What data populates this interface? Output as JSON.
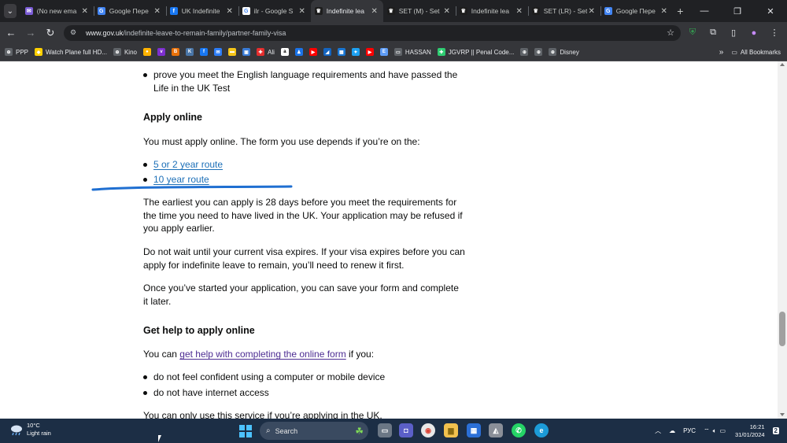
{
  "browser": {
    "tabs": [
      {
        "title": "(No new ema",
        "fav_color": "#7b5cd6",
        "fav_char": "✉",
        "active": false
      },
      {
        "title": "Google Пере",
        "fav_color": "#4285f4",
        "fav_char": "G",
        "active": false
      },
      {
        "title": "UK Indefinite",
        "fav_color": "#1877f2",
        "fav_char": "f",
        "active": false
      },
      {
        "title": "ilr - Google S",
        "fav_color": "#ffffff",
        "fav_char": "G",
        "active": false
      },
      {
        "title": "Indefinite lea",
        "fav_color": "#1d1d1d",
        "fav_char": "♛",
        "active": true
      },
      {
        "title": "SET (M) - Set",
        "fav_color": "#1d1d1d",
        "fav_char": "♛",
        "active": false
      },
      {
        "title": "Indefinite lea",
        "fav_color": "#1d1d1d",
        "fav_char": "♛",
        "active": false
      },
      {
        "title": "SET (LR) - Set",
        "fav_color": "#1d1d1d",
        "fav_char": "♛",
        "active": false
      },
      {
        "title": "Google Пере",
        "fav_color": "#4285f4",
        "fav_char": "G",
        "active": false
      }
    ],
    "address": {
      "host": "www.gov.uk",
      "path": "/indefinite-leave-to-remain-family/partner-family-visa"
    },
    "bookmarks": [
      {
        "label": "PPP",
        "color": "#5f6368",
        "char": "⊕"
      },
      {
        "label": "Watch Plane full HD...",
        "color": "#ffd000",
        "char": "◆"
      },
      {
        "label": "Kino",
        "color": "#5f6368",
        "char": "⊕"
      },
      {
        "label": "",
        "color": "#ffb300",
        "char": "●"
      },
      {
        "label": "",
        "color": "#7e2fd0",
        "char": "v"
      },
      {
        "label": "",
        "color": "#e8710a",
        "char": "B"
      },
      {
        "label": "",
        "color": "#4a76a8",
        "char": "K"
      },
      {
        "label": "",
        "color": "#1877f2",
        "char": "f"
      },
      {
        "label": "",
        "color": "#2e7df6",
        "char": "✉"
      },
      {
        "label": "",
        "color": "#f5c518",
        "char": "▬"
      },
      {
        "label": "",
        "color": "#3a7bd5",
        "char": "▣"
      },
      {
        "label": "Ali",
        "color": "#e52e2e",
        "char": "✚"
      },
      {
        "label": "",
        "color": "#ffffff",
        "char": "a"
      },
      {
        "label": "",
        "color": "#1a73e8",
        "char": "♟"
      },
      {
        "label": "",
        "color": "#ff0000",
        "char": "▶"
      },
      {
        "label": "",
        "color": "#1565c0",
        "char": "◢"
      },
      {
        "label": "",
        "color": "#1976d2",
        "char": "▦"
      },
      {
        "label": "",
        "color": "#1da1f2",
        "char": "✦"
      },
      {
        "label": "",
        "color": "#ff0000",
        "char": "▶"
      },
      {
        "label": "",
        "color": "#5e9cf5",
        "char": "E"
      },
      {
        "label": "HASSAN",
        "color": "#5f6368",
        "char": "▭"
      },
      {
        "label": "JGVRP || Penal Code...",
        "color": "#2ecc71",
        "char": "✚"
      },
      {
        "label": "",
        "color": "#5f6368",
        "char": "⊕"
      },
      {
        "label": "",
        "color": "#5f6368",
        "char": "⊕"
      },
      {
        "label": "Disney",
        "color": "#5f6368",
        "char": "⊕"
      }
    ],
    "all_bookmarks": "All Bookmarks"
  },
  "content": {
    "bullet_requirement": "prove you meet the English language requirements and have passed the Life in the UK Test",
    "heading_apply_online": "Apply online",
    "must_apply": "You must apply online. The form you use depends if you’re on the:",
    "route_links": [
      "5 or 2 year route",
      "10 year route"
    ],
    "earliest": "The earliest you can apply is 28 days before you meet the requirements for the time you need to have lived in the UK. Your application may be refused if you apply earlier.",
    "do_not_wait": "Do not wait until your current visa expires. If your visa expires before you can apply for indefinite leave to remain, you’ll need to renew it first.",
    "once_started": "Once you’ve started your application, you can save your form and complete it later.",
    "heading_get_help": "Get help to apply online",
    "help_prefix": "You can ",
    "help_link": "get help with completing the online form",
    "help_suffix": " if you:",
    "help_bullets": [
      "do not feel confident using a computer or mobile device",
      "do not have internet access"
    ],
    "only_use": "You can only use this service if you’re applying in the UK."
  },
  "taskbar": {
    "temperature": "10°C",
    "weather": "Light rain",
    "search_label": "Search",
    "language": "РУС",
    "time": "16:21",
    "date": "31/01/2024"
  },
  "colors": {
    "link": "#1d70b8",
    "visited_link": "#4c2c92",
    "annotation": "#1f6fd1"
  }
}
